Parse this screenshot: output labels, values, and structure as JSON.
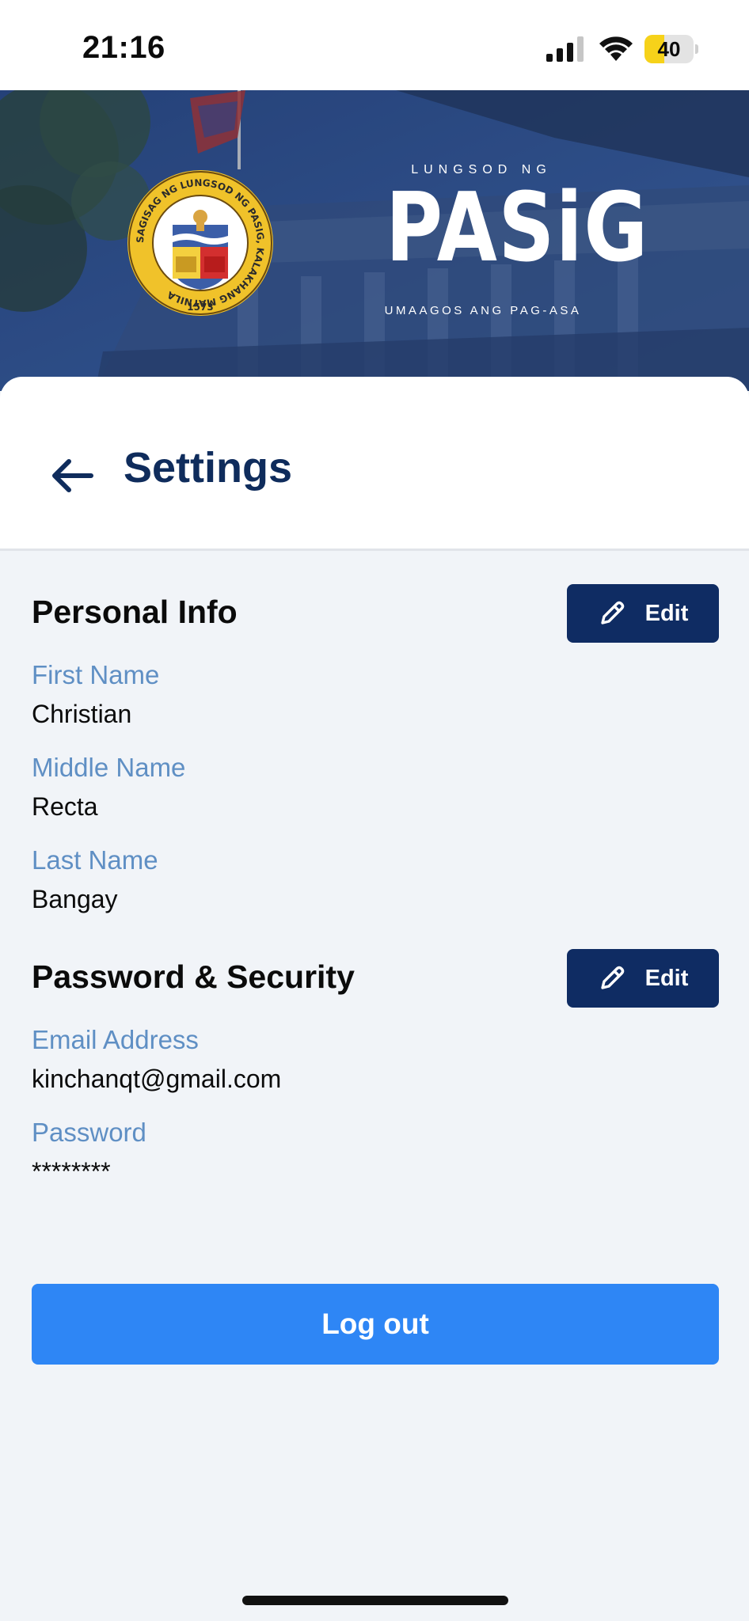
{
  "status_bar": {
    "time": "21:16",
    "battery_level": "40",
    "battery_fraction": 0.4,
    "icons": [
      "signal-icon",
      "wifi-icon",
      "battery-icon"
    ]
  },
  "banner": {
    "logo_top": "LUNGSOD NG",
    "logo_name": "PASiG",
    "logo_tagline": "UMAAGOS ANG PAG-ASA",
    "seal_text": "SAGISAG NG LUNGSOD NG PASIG, KALAKHANG MAYNILA",
    "seal_year": "1573"
  },
  "header": {
    "title": "Settings",
    "back_icon": "arrow-left-icon"
  },
  "personal_info": {
    "title": "Personal Info",
    "edit_label": "Edit",
    "fields": [
      {
        "label": "First Name",
        "value": "Christian"
      },
      {
        "label": "Middle Name",
        "value": "Recta"
      },
      {
        "label": "Last Name",
        "value": "Bangay"
      }
    ]
  },
  "security": {
    "title": "Password & Security",
    "edit_label": "Edit",
    "fields": [
      {
        "label": "Email Address",
        "value": "kinchanqt@gmail.com"
      },
      {
        "label": "Password",
        "value": "********"
      }
    ]
  },
  "logout_label": "Log out",
  "colors": {
    "navy": "#0f2c63",
    "title_navy": "#0f2c5c",
    "label_blue": "#5f8fc4",
    "logout_blue": "#2e86f5",
    "background": "#f1f4f8",
    "battery_yellow": "#f6d21a"
  }
}
